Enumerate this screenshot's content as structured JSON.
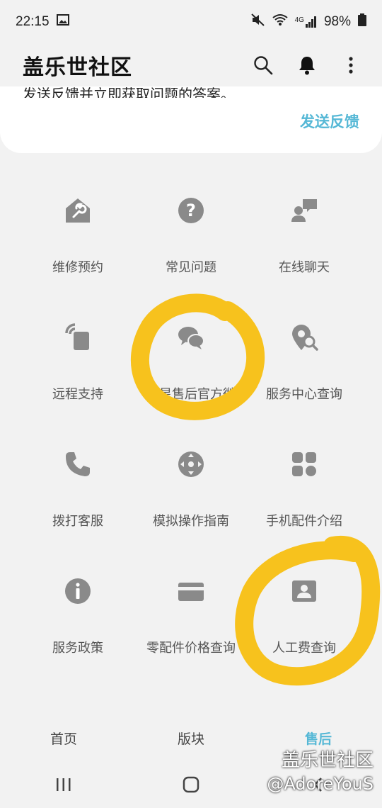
{
  "status": {
    "time": "22:15",
    "network": "4G",
    "battery": "98%"
  },
  "app": {
    "title": "盖乐世社区"
  },
  "feedback": {
    "description": "发送反馈并立即获取问题的答案。",
    "link": "发送反馈"
  },
  "services": [
    {
      "label": "维修预约",
      "icon": "wrench-tag-icon"
    },
    {
      "label": "常见问题",
      "icon": "question-circle-icon"
    },
    {
      "label": "在线聊天",
      "icon": "chat-person-icon"
    },
    {
      "label": "远程支持",
      "icon": "remote-device-icon"
    },
    {
      "label": "三星售后官方微",
      "icon": "wechat-icon"
    },
    {
      "label": "服务中心查询",
      "icon": "location-search-icon"
    },
    {
      "label": "拨打客服",
      "icon": "phone-icon"
    },
    {
      "label": "模拟操作指南",
      "icon": "directional-pad-icon"
    },
    {
      "label": "手机配件介绍",
      "icon": "apps-grid-icon"
    },
    {
      "label": "服务政策",
      "icon": "info-circle-icon"
    },
    {
      "label": "零配件价格查询",
      "icon": "card-icon"
    },
    {
      "label": "人工费查询",
      "icon": "id-card-icon"
    }
  ],
  "nav": {
    "tabs": [
      {
        "label": "首页",
        "active": false
      },
      {
        "label": "版块",
        "active": false
      },
      {
        "label": "售后",
        "active": true
      }
    ]
  },
  "watermark": {
    "line1": "盖乐世社区",
    "line2": "@AdoreYouS"
  },
  "colors": {
    "accent": "#56b8d6",
    "icon": "#8a8a8a",
    "highlight": "#f7c21d"
  }
}
